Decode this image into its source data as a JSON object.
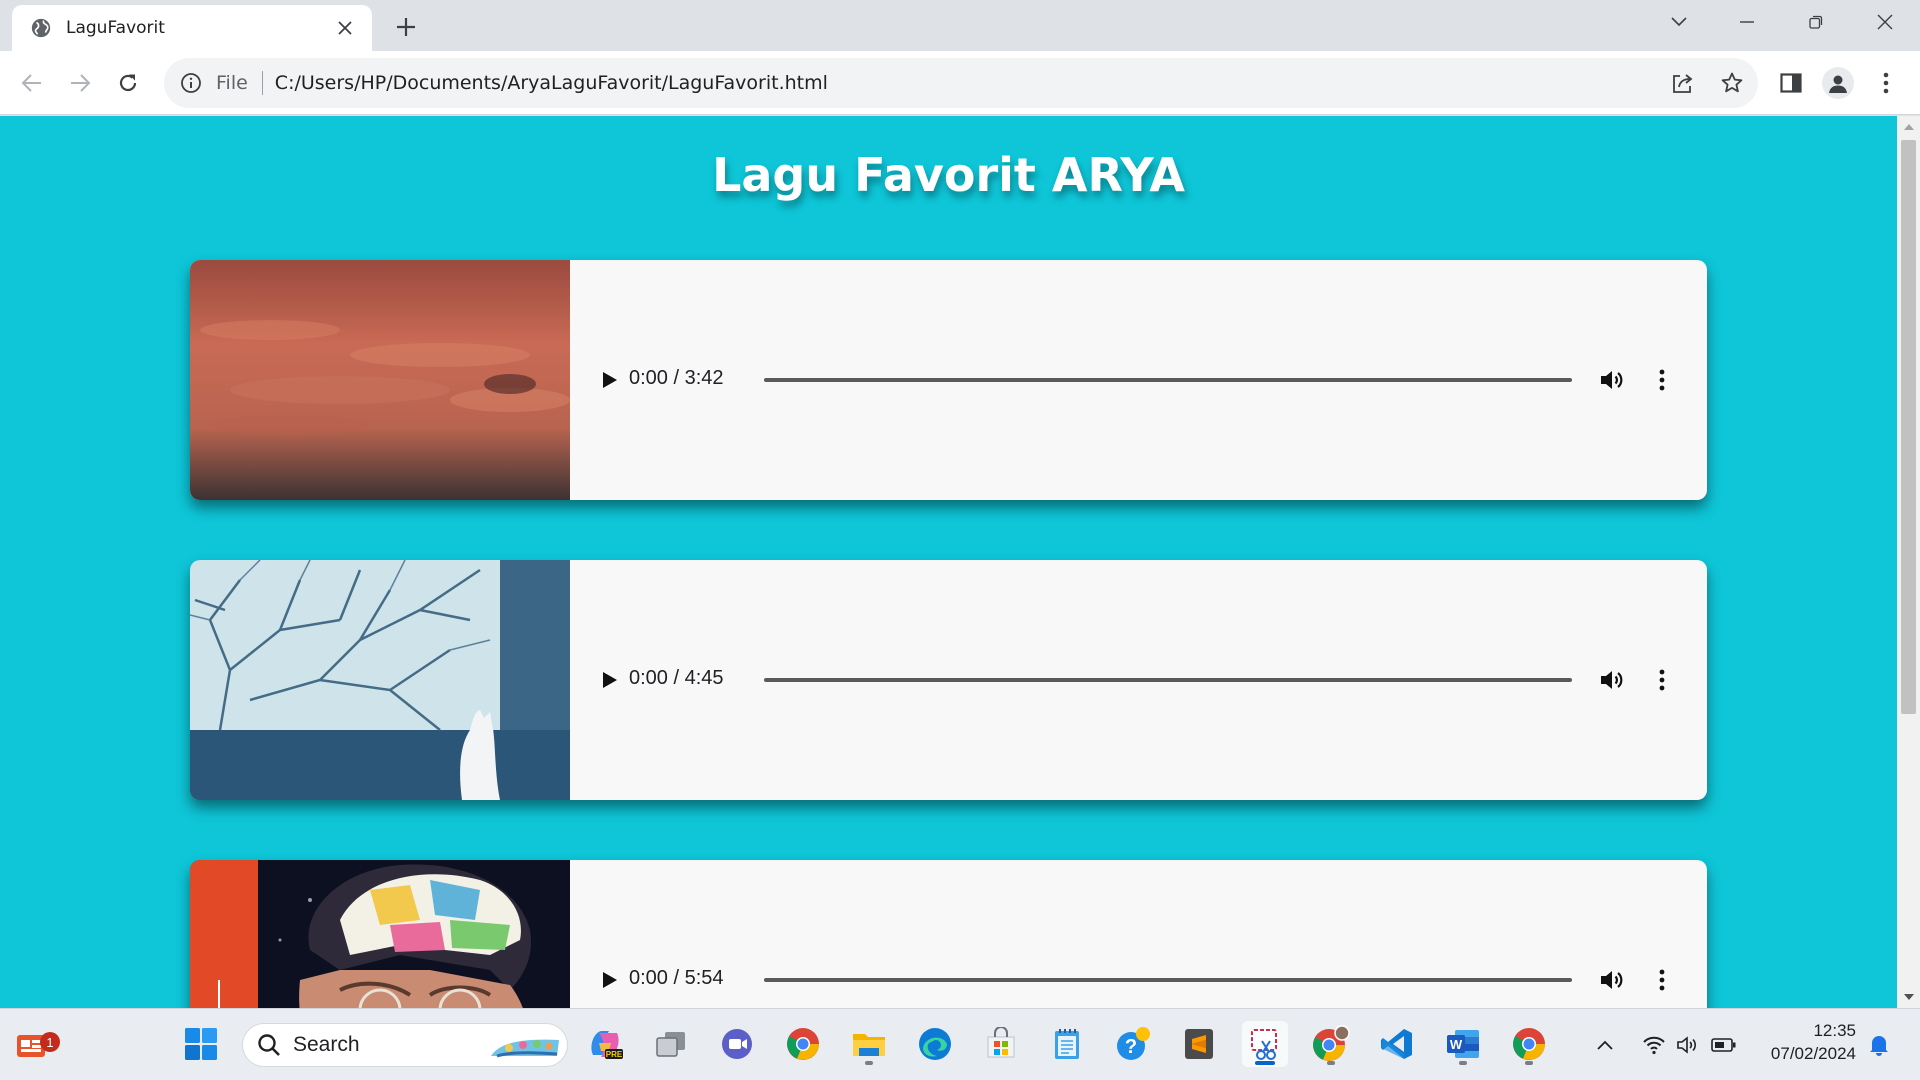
{
  "browser": {
    "tab_title": "LaguFavorit",
    "scheme_label": "File",
    "url": "C:/Users/HP/Documents/AryaLaguFavorit/LaguFavorit.html"
  },
  "page": {
    "title": "Lagu Favorit ARYA",
    "songs": [
      {
        "time": "0:00 / 3:42",
        "progress": 0,
        "cover": "orange-cloudy-sky"
      },
      {
        "time": "0:00 / 4:45",
        "progress": 0,
        "cover": "white-cat-window-tree"
      },
      {
        "time": "0:00 / 5:54",
        "progress": 0,
        "cover": "kunto-aji-portrait"
      }
    ]
  },
  "taskbar": {
    "widgets_badge": "1",
    "search_label": "Search",
    "time": "12:35",
    "date": "07/02/2024",
    "apps": [
      "copilot-icon",
      "task-view-icon",
      "teams-meet-icon",
      "chrome-icon",
      "file-explorer-icon",
      "edge-icon",
      "microsoft-store-icon",
      "notepad-icon",
      "get-help-icon",
      "sublime-text-icon",
      "snipping-tool-icon",
      "chrome-profile-icon",
      "vscode-icon",
      "word-icon",
      "chrome-icon"
    ]
  },
  "colors": {
    "page_background": "#0ec6d8",
    "card_background": "#f8f8f8",
    "title_text": "#ffffff"
  }
}
